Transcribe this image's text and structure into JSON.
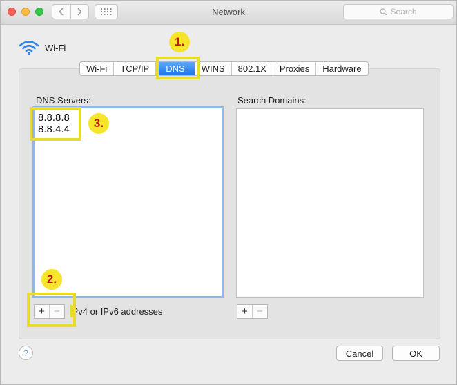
{
  "window": {
    "title": "Network",
    "search_placeholder": "Search"
  },
  "interface": {
    "name": "Wi-Fi"
  },
  "tabs": [
    {
      "label": "Wi-Fi"
    },
    {
      "label": "TCP/IP"
    },
    {
      "label": "DNS",
      "active": true
    },
    {
      "label": "WINS"
    },
    {
      "label": "802.1X"
    },
    {
      "label": "Proxies"
    },
    {
      "label": "Hardware"
    }
  ],
  "dns": {
    "label": "DNS Servers:",
    "servers": [
      "8.8.8.8",
      "8.8.4.4"
    ],
    "hint": "IPv4 or IPv6 addresses"
  },
  "search_domains": {
    "label": "Search Domains:"
  },
  "controls": {
    "plus": "+",
    "minus": "−"
  },
  "annotations": {
    "step1": "1.",
    "step2": "2.",
    "step3": "3."
  },
  "footer": {
    "help": "?",
    "cancel": "Cancel",
    "ok": "OK"
  },
  "colors": {
    "accent": "#1b74e8",
    "highlight": "#e8dc2a",
    "badge_fill": "#f6e52a",
    "badge_text": "#c8161e"
  }
}
